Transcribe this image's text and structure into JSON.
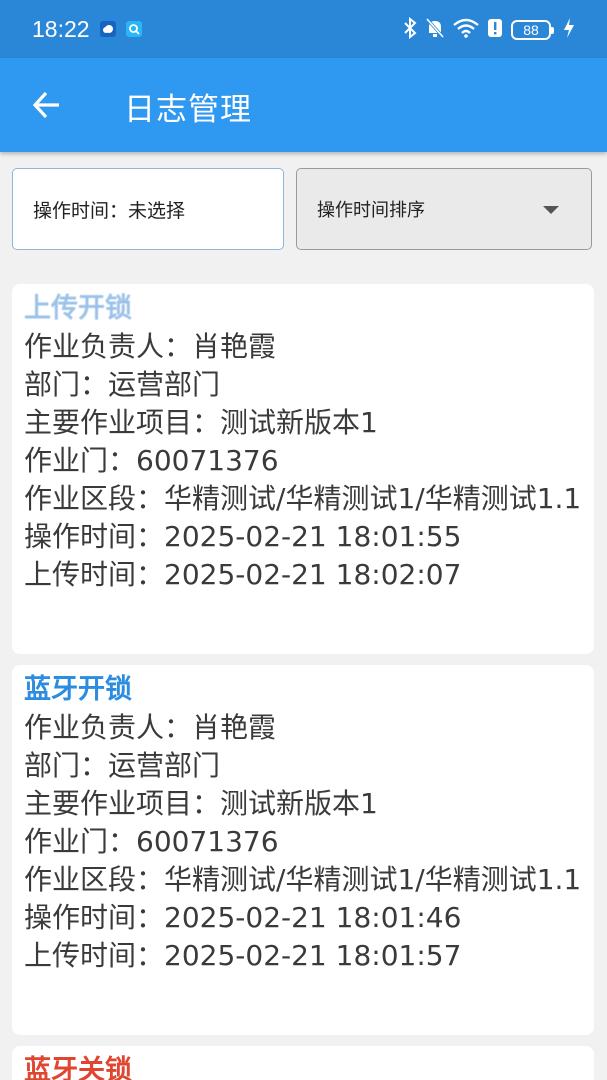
{
  "status_bar": {
    "time": "18:22",
    "battery": "88",
    "icons": [
      "weather-icon",
      "search-app-icon",
      "bluetooth-icon",
      "mute-icon",
      "wifi-icon",
      "alert-icon",
      "charging-icon"
    ]
  },
  "app_bar": {
    "title": "日志管理",
    "back_icon": "arrow-left-icon"
  },
  "filters": {
    "time_filter": "操作时间：未选择",
    "sort_select": "操作时间排序"
  },
  "labels": {
    "person": "作业负责人：",
    "dept": "部门：",
    "project": "主要作业项目：",
    "door": "作业门：",
    "section": "作业区段：",
    "op_time": "操作时间：",
    "upload_time": "上传时间："
  },
  "logs": [
    {
      "title": "上传开锁",
      "title_color": "#4a8fd6",
      "person": "肖艳霞",
      "dept": "运营部门",
      "project": "测试新版本1",
      "door": "60071376",
      "section": "华精测试/华精测试1/华精测试1.1",
      "op_time": "2025-02-21 18:01:55",
      "upload_time": "2025-02-21 18:02:07"
    },
    {
      "title": "蓝牙开锁",
      "title_color": "#2b8ce0",
      "person": "肖艳霞",
      "dept": "运营部门",
      "project": "测试新版本1",
      "door": "60071376",
      "section": "华精测试/华精测试1/华精测试1.1",
      "op_time": "2025-02-21 18:01:46",
      "upload_time": "2025-02-21 18:01:57"
    },
    {
      "title": "蓝牙关锁",
      "title_color": "#e0452f"
    }
  ]
}
